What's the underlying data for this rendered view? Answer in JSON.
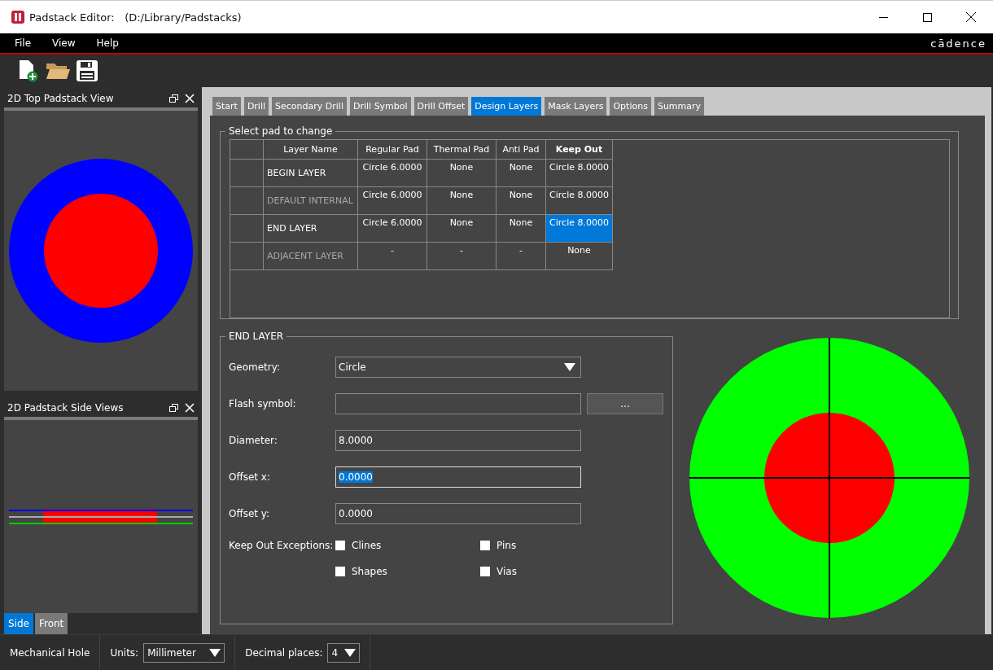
{
  "window": {
    "title": "Padstack Editor:",
    "path": "(D:/Library/Padstacks)"
  },
  "menu": [
    "File",
    "View",
    "Help"
  ],
  "brand": "cādence",
  "docks": [
    {
      "title": "2D Top Padstack View"
    },
    {
      "title": "2D Padstack Side Views"
    }
  ],
  "side_tabs": [
    {
      "label": "Side",
      "selected": true
    },
    {
      "label": "Front",
      "selected": false
    }
  ],
  "tabs": [
    {
      "label": "Start",
      "selected": false
    },
    {
      "label": "Drill",
      "selected": false
    },
    {
      "label": "Secondary Drill",
      "selected": false
    },
    {
      "label": "Drill Symbol",
      "selected": false
    },
    {
      "label": "Drill Offset",
      "selected": false
    },
    {
      "label": "Design Layers",
      "selected": true
    },
    {
      "label": "Mask Layers",
      "selected": false
    },
    {
      "label": "Options",
      "selected": false
    },
    {
      "label": "Summary",
      "selected": false
    }
  ],
  "pad_group": {
    "title": "Select pad to change",
    "columns": [
      {
        "label": "Layer Name",
        "bold": false
      },
      {
        "label": "Regular Pad",
        "bold": false
      },
      {
        "label": "Thermal Pad",
        "bold": false
      },
      {
        "label": "Anti Pad",
        "bold": false
      },
      {
        "label": "Keep Out",
        "bold": true
      }
    ],
    "rows": [
      {
        "muted": false,
        "cells": [
          {
            "text": "BEGIN LAYER",
            "selected": false
          },
          {
            "text": "Circle 6.0000",
            "selected": false
          },
          {
            "text": "None",
            "selected": false
          },
          {
            "text": "None",
            "selected": false
          },
          {
            "text": "Circle 8.0000",
            "selected": false
          }
        ]
      },
      {
        "muted": true,
        "cells": [
          {
            "text": "DEFAULT INTERNAL",
            "selected": false
          },
          {
            "text": "Circle 6.0000",
            "selected": false
          },
          {
            "text": "None",
            "selected": false
          },
          {
            "text": "None",
            "selected": false
          },
          {
            "text": "Circle 8.0000",
            "selected": false
          }
        ]
      },
      {
        "muted": false,
        "cells": [
          {
            "text": "END LAYER",
            "selected": false
          },
          {
            "text": "Circle 6.0000",
            "selected": false
          },
          {
            "text": "None",
            "selected": false
          },
          {
            "text": "None",
            "selected": false
          },
          {
            "text": "Circle 8.0000",
            "selected": true
          }
        ]
      },
      {
        "muted": true,
        "cells": [
          {
            "text": "ADJACENT LAYER",
            "selected": false
          },
          {
            "text": "-",
            "selected": false
          },
          {
            "text": "-",
            "selected": false
          },
          {
            "text": "-",
            "selected": false
          },
          {
            "text": "None",
            "selected": false
          }
        ]
      }
    ]
  },
  "layer_group": {
    "title": "END LAYER",
    "fields": [
      {
        "kind": "select",
        "label": "Geometry:",
        "value": "Circle",
        "focused": false
      },
      {
        "kind": "browse",
        "label": "Flash symbol:",
        "button": "...",
        "focused": false
      },
      {
        "kind": "text",
        "label": "Diameter:",
        "value": "8.0000",
        "focused": false
      },
      {
        "kind": "text",
        "label": "Offset x:",
        "value": "0.0000",
        "focused": true
      },
      {
        "kind": "text",
        "label": "Offset y:",
        "value": "0.0000",
        "focused": false
      }
    ],
    "exceptions_label": "Keep Out Exceptions:",
    "exceptions": [
      {
        "label": "Clines",
        "checked": false
      },
      {
        "label": "Pins",
        "checked": false
      },
      {
        "label": "Shapes",
        "checked": false
      },
      {
        "label": "Vias",
        "checked": false
      }
    ]
  },
  "status_bar": {
    "type": "Mechanical Hole",
    "units_label": "Units:",
    "units": "Millimeter",
    "decimal_label": "Decimal places:",
    "decimal": "4"
  }
}
